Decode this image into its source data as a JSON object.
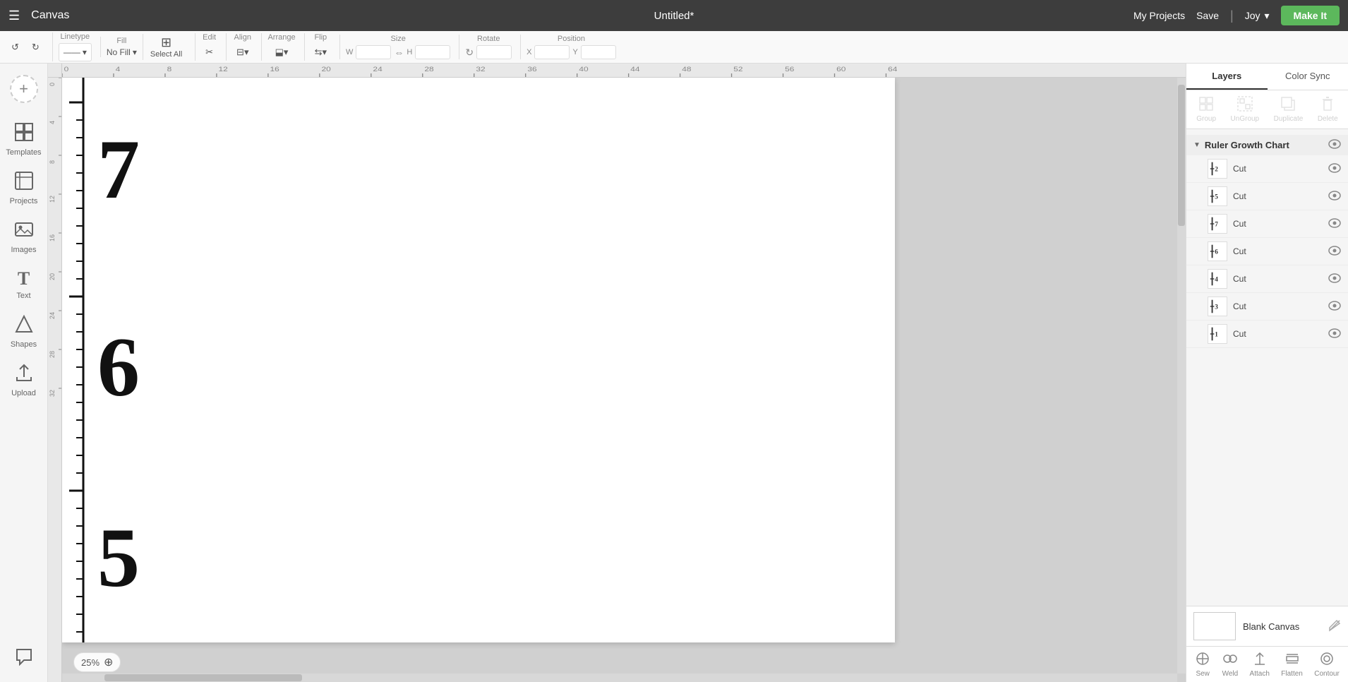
{
  "header": {
    "menu_label": "☰",
    "app_name": "Canvas",
    "title": "Untitled*",
    "my_projects": "My Projects",
    "save": "Save",
    "divider": "|",
    "user_name": "Joy",
    "user_chevron": "▾",
    "make_it": "Make It"
  },
  "toolbar": {
    "undo": "↺",
    "redo": "↻",
    "linetype_label": "Linetype",
    "fill_label": "Fill",
    "select_all_label": "Select All",
    "edit_label": "Edit",
    "align_label": "Align",
    "arrange_label": "Arrange",
    "flip_label": "Flip",
    "size_label": "Size",
    "rotate_label": "Rotate",
    "position_label": "Position",
    "w_label": "W",
    "h_label": "H",
    "x_label": "X",
    "y_label": "Y",
    "no_fill": "No Fill",
    "cut_dropdown": "Cut ▾"
  },
  "sidebar": {
    "new_label": "New",
    "items": [
      {
        "id": "new",
        "icon": "+",
        "label": ""
      },
      {
        "id": "templates",
        "icon": "◫",
        "label": "Templates"
      },
      {
        "id": "projects",
        "icon": "⊞",
        "label": "Projects"
      },
      {
        "id": "images",
        "icon": "🖼",
        "label": "Images"
      },
      {
        "id": "text",
        "icon": "T",
        "label": "Text"
      },
      {
        "id": "shapes",
        "icon": "⬡",
        "label": "Shapes"
      },
      {
        "id": "upload",
        "icon": "⬆",
        "label": "Upload"
      }
    ]
  },
  "ruler": {
    "ticks": [
      0,
      4,
      8,
      12,
      16,
      20,
      24,
      28,
      32,
      36,
      40,
      44,
      48,
      52,
      56,
      60,
      64
    ]
  },
  "canvas": {
    "zoom": "25%",
    "zoom_plus_icon": "⊕"
  },
  "right_panel": {
    "tabs": [
      {
        "id": "layers",
        "label": "Layers",
        "active": true
      },
      {
        "id": "color_sync",
        "label": "Color Sync",
        "active": false
      }
    ],
    "actions": [
      {
        "id": "group",
        "label": "Group",
        "disabled": true
      },
      {
        "id": "ungroup",
        "label": "UnGroup",
        "disabled": true
      },
      {
        "id": "duplicate",
        "label": "Duplicate",
        "disabled": true
      },
      {
        "id": "delete",
        "label": "Delete",
        "disabled": true
      }
    ],
    "layer_group": {
      "name": "Ruler Growth Chart",
      "expanded": true
    },
    "layers": [
      {
        "id": "l1",
        "number": "2",
        "name": "Cut",
        "visible": true
      },
      {
        "id": "l2",
        "number": "5",
        "name": "Cut",
        "visible": true
      },
      {
        "id": "l3",
        "number": "7",
        "name": "Cut",
        "visible": true
      },
      {
        "id": "l4",
        "number": "6",
        "name": "Cut",
        "visible": true
      },
      {
        "id": "l5",
        "number": "4",
        "name": "Cut",
        "visible": true
      },
      {
        "id": "l6",
        "number": "3",
        "name": "Cut",
        "visible": true
      },
      {
        "id": "l7",
        "number": "1",
        "name": "Cut",
        "visible": true
      }
    ],
    "blank_canvas": {
      "name": "Blank Canvas",
      "edit_icon": "✎"
    },
    "bottom_actions": [
      {
        "id": "sew",
        "label": "Sew",
        "disabled": false
      },
      {
        "id": "weld",
        "label": "Weld",
        "disabled": false
      },
      {
        "id": "attach",
        "label": "Attach",
        "disabled": false
      },
      {
        "id": "flatten",
        "label": "Flatten",
        "disabled": false
      },
      {
        "id": "contour",
        "label": "Contour",
        "disabled": false
      }
    ]
  }
}
